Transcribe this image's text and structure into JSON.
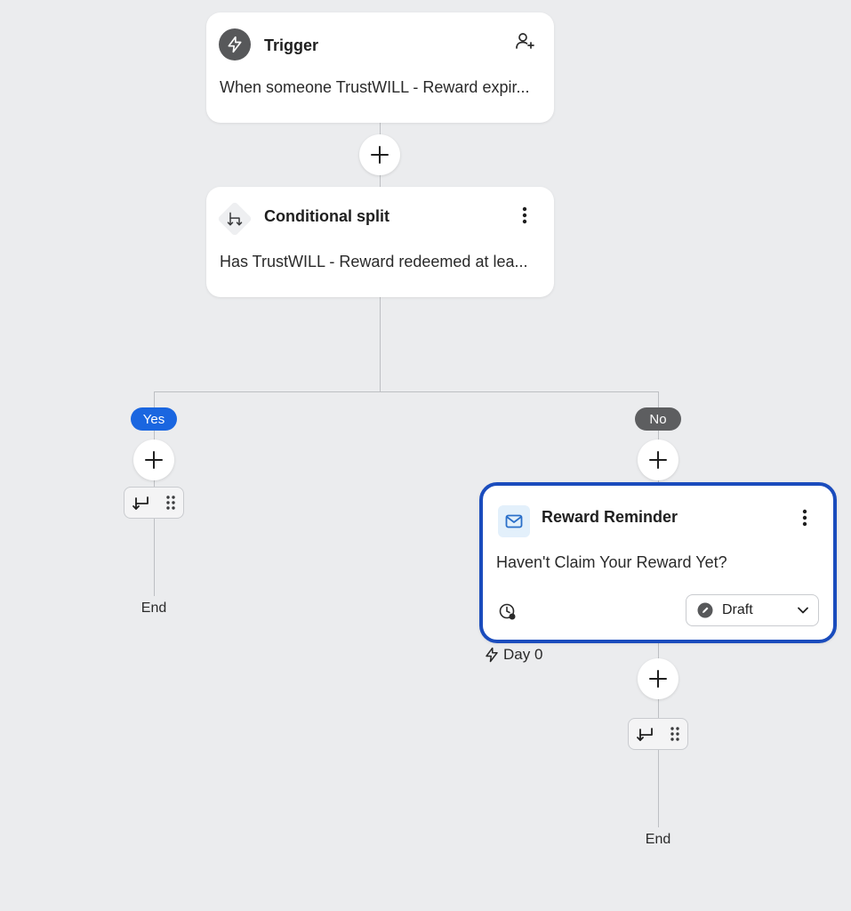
{
  "trigger": {
    "title": "Trigger",
    "description": "When someone TrustWILL - Reward expir..."
  },
  "split": {
    "title": "Conditional split",
    "description": "Has TrustWILL - Reward redeemed at lea..."
  },
  "branches": {
    "yes_label": "Yes",
    "no_label": "No",
    "yes_color": "#1a66e0",
    "no_color": "#5d5e60"
  },
  "email": {
    "title": "Reward Reminder",
    "subject": "Haven't Claim Your Reward Yet?",
    "status": "Draft",
    "delay": "Day 0"
  },
  "end_labels": {
    "left": "End",
    "right": "End"
  },
  "colors": {
    "accent_selected": "#1a4cbd",
    "background": "#ebecee"
  },
  "icons": {
    "trigger": "lightning-icon",
    "profile": "add-person-icon",
    "split": "split-arrows-icon",
    "email": "mail-icon",
    "exit": "exit-arrow-icon",
    "drag": "drag-handle-icon",
    "smart_send": "clock-settings-icon",
    "draft": "pencil-circle-icon"
  }
}
